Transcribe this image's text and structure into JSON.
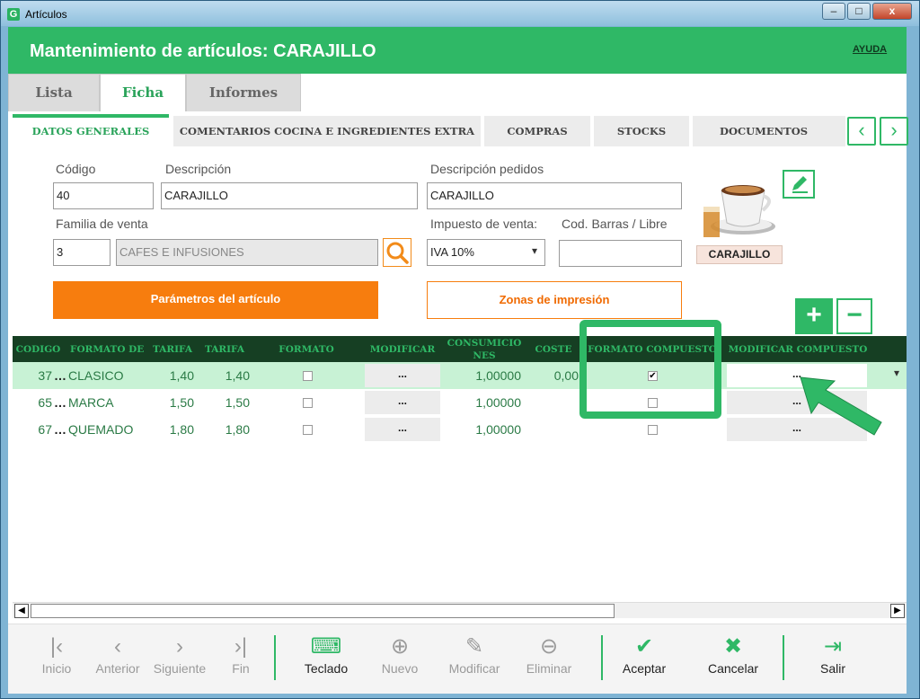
{
  "window": {
    "title": "Artículos",
    "app_icon": "G",
    "buttons": [
      "–",
      "□",
      "x"
    ]
  },
  "header": {
    "title": "Mantenimiento de artículos: CARAJILLO",
    "help": "AYUDA"
  },
  "main_tabs": [
    {
      "label": "Lista",
      "active": false
    },
    {
      "label": "Ficha",
      "active": true
    },
    {
      "label": "Informes",
      "active": false
    }
  ],
  "sub_tabs": [
    {
      "label": "DATOS GENERALES",
      "active": true
    },
    {
      "label": "COMENTARIOS COCINA E INGREDIENTES EXTRA",
      "active": false
    },
    {
      "label": "COMPRAS",
      "active": false
    },
    {
      "label": "STOCKS",
      "active": false
    },
    {
      "label": "DOCUMENTOS COMPRA",
      "active": false
    }
  ],
  "form": {
    "codigo_label": "Código",
    "codigo_value": "40",
    "descripcion_label": "Descripción",
    "descripcion_value": "CARAJILLO",
    "desc_pedidos_label": "Descripción pedidos",
    "desc_pedidos_value": "CARAJILLO",
    "familia_label": "Familia de venta",
    "familia_code": "3",
    "familia_name": "CAFES E INFUSIONES",
    "impuesto_label": "Impuesto de venta:",
    "impuesto_value": "IVA 10%",
    "codbarras_label": "Cod. Barras / Libre",
    "codbarras_value": "",
    "photo_caption": "CARAJILLO",
    "parametros_button": "Parámetros del artículo",
    "zonas_button": "Zonas de impresión"
  },
  "grid": {
    "headers": [
      "CODIGO",
      "FORMATO DE",
      "TARIFA",
      "TARIFA",
      "FORMATO",
      "MODIFICAR",
      "CONSUMICIO NES",
      "COSTE",
      "FORMATO COMPUESTO",
      "MODIFICAR COMPUESTO"
    ],
    "rows": [
      {
        "codigo": "37",
        "formato": "CLASICO",
        "tarifa1": "1,40",
        "tarifa2": "1,40",
        "modificar": "...",
        "consumiciones": "1,00000",
        "coste": "0,00",
        "compuesto": true,
        "mod_compuesto": "...",
        "selected": true
      },
      {
        "codigo": "65",
        "formato": "MARCA",
        "tarifa1": "1,50",
        "tarifa2": "1,50",
        "modificar": "...",
        "consumiciones": "1,00000",
        "coste": "",
        "compuesto": false,
        "mod_compuesto": "...",
        "selected": false
      },
      {
        "codigo": "67",
        "formato": "QUEMADO",
        "tarifa1": "1,80",
        "tarifa2": "1,80",
        "modificar": "...",
        "consumiciones": "1,00000",
        "coste": "",
        "compuesto": false,
        "mod_compuesto": "...",
        "selected": false
      }
    ]
  },
  "toolbar": {
    "inicio": "Inicio",
    "anterior": "Anterior",
    "siguiente": "Siguiente",
    "fin": "Fin",
    "teclado": "Teclado",
    "nuevo": "Nuevo",
    "modificar": "Modificar",
    "eliminar": "Eliminar",
    "aceptar": "Aceptar",
    "cancelar": "Cancelar",
    "salir": "Salir"
  },
  "colors": {
    "accent": "#2fb866",
    "orange": "#f77d0e",
    "grid_header": "#163f23",
    "selected_row": "#c8f2d5"
  }
}
